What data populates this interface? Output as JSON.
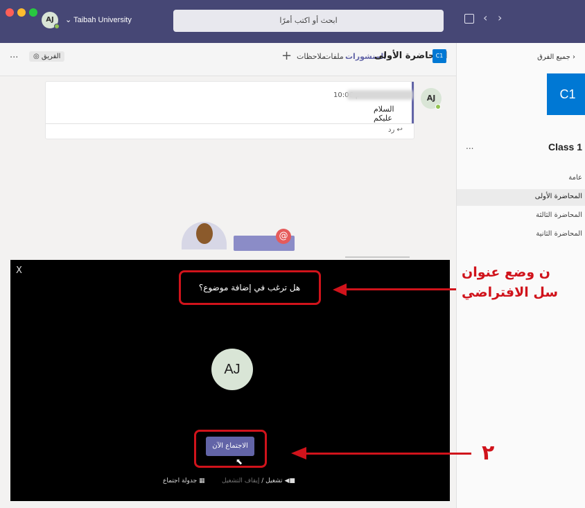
{
  "titlebar": {
    "avatar_initials": "AJ",
    "org_name": "Taibah University",
    "search_placeholder": "ابحث أو اكتب أمرًا"
  },
  "channel_header": {
    "team_icon_text": "C1",
    "channel_title": "المحاضرة الأولى",
    "tabs": [
      "المنشورات",
      "ملفات",
      "ملاحظات"
    ],
    "add_tab": "+",
    "team_button": "الفريق",
    "more": "..."
  },
  "post": {
    "author_initials": "AJ",
    "time": "10:06 م",
    "message": "السلام عليكم",
    "reply_label": "رد"
  },
  "sidebar": {
    "back_label": "جميع الفرق",
    "team_tile": "C1",
    "team_name": "Class 1",
    "more": "...",
    "channels": [
      "عامة",
      "المحاضرة الأولى",
      "المحاضرة الثالثة",
      "المحاضرة الثانية"
    ]
  },
  "meeting_dialog": {
    "close": "X",
    "subject_prompt": "هل ترغب في إضافة موضوع؟",
    "avatar_initials": "AJ",
    "meet_now_button": "الاجتماع الآن",
    "camera_on": "تشغيل",
    "separator": "/",
    "camera_off": "إيقاف التشغيل",
    "schedule_meeting": "جدولة اجتماع"
  },
  "annotations": {
    "line1": "ن وضع عنوان",
    "line2": "سل الافتراضي",
    "step_number": "٢"
  },
  "colors": {
    "titlebar": "#464775",
    "accent": "#6264a7",
    "annotation_red": "#d0131b"
  }
}
